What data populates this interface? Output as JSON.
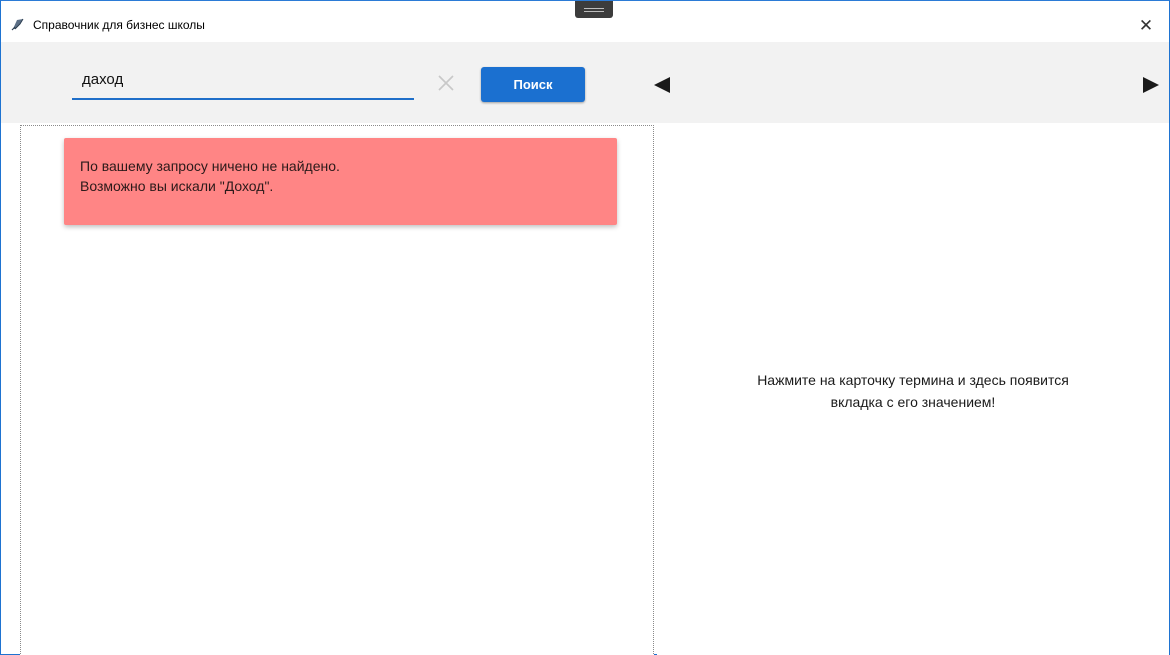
{
  "window": {
    "title": "Справочник для бизнес школы",
    "close_glyph": "✕"
  },
  "toolbar": {
    "search_value": "даход",
    "search_placeholder": "",
    "clear_icon": "close-icon",
    "search_button_label": "Поиск",
    "prev_icon": "triangle-left-icon",
    "next_icon": "triangle-right-icon"
  },
  "results": {
    "error_line1": "По вашему запросу ничено не найдено.",
    "error_line2": "Возможно вы искали \"Доход\"."
  },
  "detail": {
    "hint_line1": "Нажмите на карточку термина и здесь появится",
    "hint_line2": "вкладка с его значением!"
  },
  "colors": {
    "accent": "#1b70d0",
    "error_card": "#ff8585",
    "toolbar_bg": "#f2f2f2"
  }
}
